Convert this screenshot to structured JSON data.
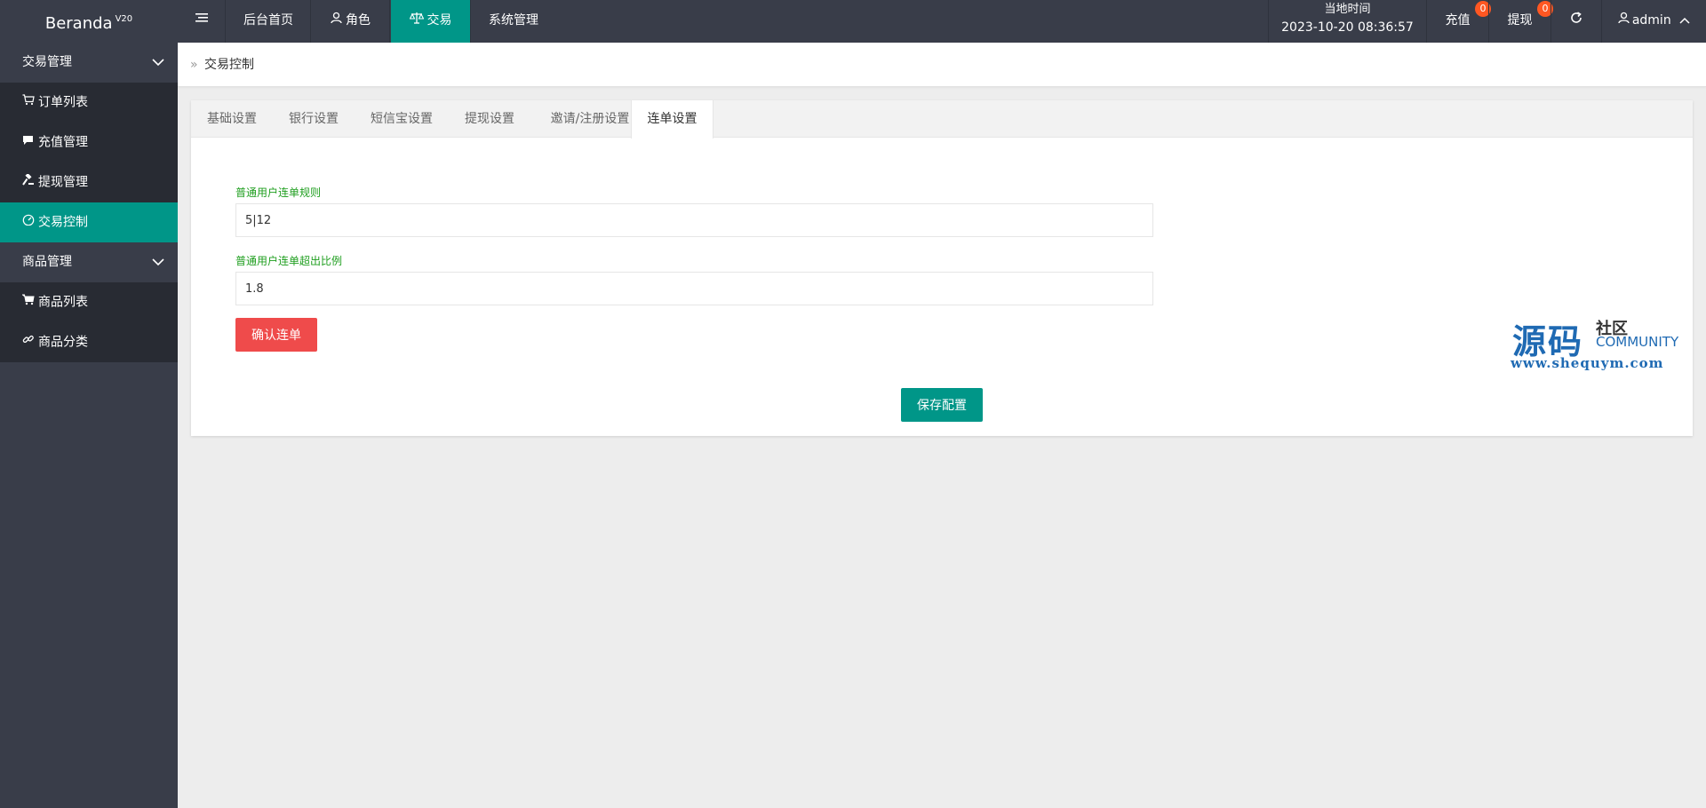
{
  "header": {
    "brand": "Beranda",
    "brand_version": "V20",
    "nav": [
      {
        "label": ""
      },
      {
        "label": "后台首页"
      },
      {
        "label": "角色"
      },
      {
        "label": "交易"
      },
      {
        "label": "系统管理"
      }
    ],
    "time_label": "当地时间",
    "time_value": "2023-10-20 08:36:57",
    "recharge_label": "充值",
    "recharge_count": "0",
    "withdraw_label": "提现",
    "withdraw_count": "0",
    "user": "admin"
  },
  "sidebar": {
    "groups": [
      {
        "label": "交易管理",
        "items": [
          "订单列表",
          "充值管理",
          "提现管理",
          "交易控制"
        ]
      },
      {
        "label": "商品管理",
        "items": [
          "商品列表",
          "商品分类"
        ]
      }
    ]
  },
  "breadcrumb": {
    "current": "交易控制"
  },
  "tabs": [
    "基础设置",
    "银行设置",
    "短信宝设置",
    "提现设置",
    "邀请/注册设置",
    "连单设置"
  ],
  "form": {
    "field1_label": "普通用户连单规则",
    "field1_value": "5|12",
    "field2_label": "普通用户连单超出比例",
    "field2_value": "1.8",
    "confirm_label": "确认连单",
    "save_label": "保存配置"
  },
  "watermark": {
    "big": "源码",
    "small": "社区",
    "community": "COMMUNITY",
    "url": "www.shequym.com"
  },
  "colors": {
    "header_bg": "#393d49",
    "accent": "#009688",
    "danger": "#ef4b4b",
    "badge": "#ff5722",
    "label_green": "#1e9e1e"
  }
}
